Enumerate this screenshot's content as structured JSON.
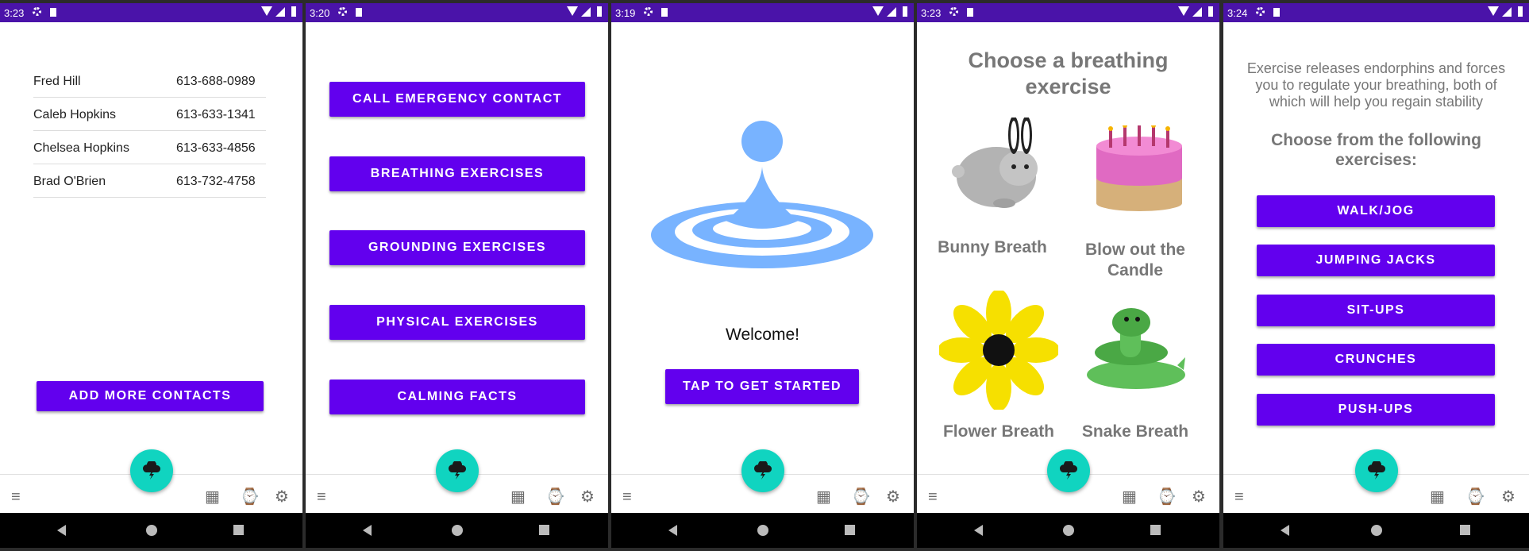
{
  "screens": [
    {
      "status_time": "3:23",
      "contacts": [
        {
          "name": "Fred Hill",
          "phone": "613-688-0989"
        },
        {
          "name": "Caleb Hopkins",
          "phone": "613-633-1341"
        },
        {
          "name": "Chelsea Hopkins",
          "phone": "613-633-4856"
        },
        {
          "name": "Brad O'Brien",
          "phone": "613-732-4758"
        }
      ],
      "add_button": "ADD MORE CONTACTS"
    },
    {
      "status_time": "3:20",
      "menu": [
        "CALL EMERGENCY CONTACT",
        "BREATHING EXERCISES",
        "GROUNDING EXERCISES",
        "PHYSICAL EXERCISES",
        "CALMING FACTS"
      ]
    },
    {
      "status_time": "3:19",
      "welcome": "Welcome!",
      "start_button": "TAP TO GET STARTED"
    },
    {
      "status_time": "3:23",
      "title": "Choose a breathing exercise",
      "exercises": [
        "Bunny Breath",
        "Blow out the Candle",
        "Flower Breath",
        "Snake Breath"
      ]
    },
    {
      "status_time": "3:24",
      "intro": "Exercise releases endorphins and forces you to regulate your breathing, both of which will help you regain stability",
      "subtitle": "Choose from the following exercises:",
      "exercises": [
        "WALK/JOG",
        "JUMPING JACKS",
        "SIT-UPS",
        "CRUNCHES",
        "PUSH-UPS"
      ]
    }
  ],
  "theme": {
    "status_bar": "#4a13a9",
    "primary": "#6200ee",
    "fab": "#10d4c0",
    "water": "#78b3ff"
  },
  "icons": {
    "fab": "storm-cloud-icon",
    "nav": [
      "menu-icon",
      "calendar-icon",
      "watch-icon",
      "settings-icon"
    ],
    "system": [
      "back-icon",
      "home-icon",
      "recents-icon"
    ]
  }
}
